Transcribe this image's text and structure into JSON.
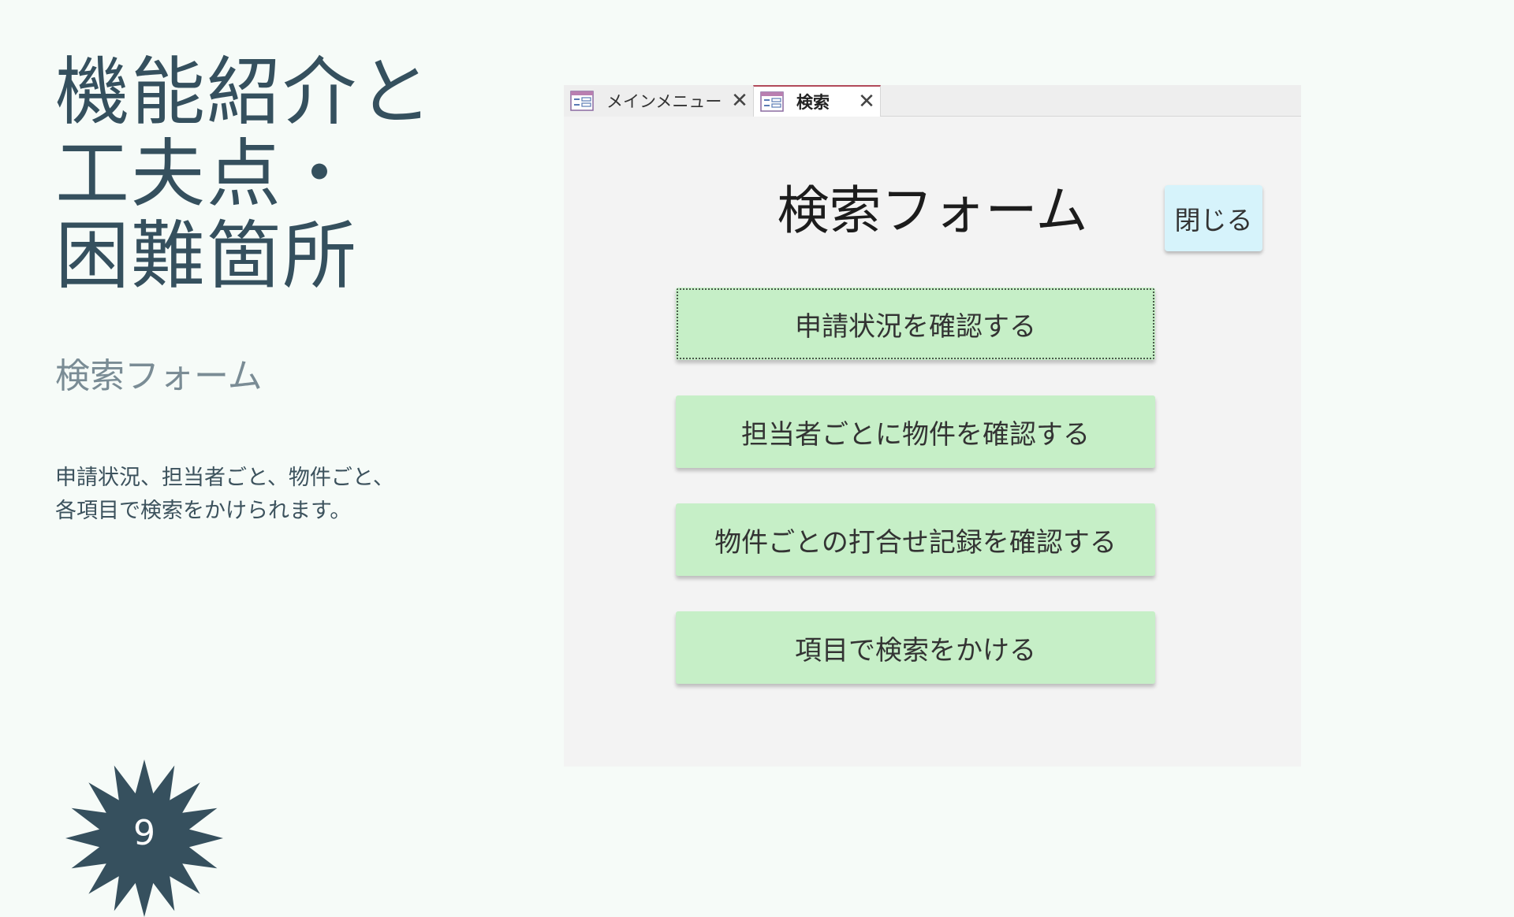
{
  "slide": {
    "title_lines": [
      "機能紹介と",
      "工夫点・",
      "困難箇所"
    ],
    "subtitle": "検索フォーム",
    "description_lines": [
      "申請状況、担当者ごと、物件ごと、",
      "各項目で検索をかけられます。"
    ],
    "page_number": "9"
  },
  "app": {
    "tabs": [
      {
        "label": "メインメニュー",
        "close": "✕",
        "icon": "form-icon",
        "active": false
      },
      {
        "label": "検索",
        "close": "✕",
        "icon": "form-icon",
        "active": true
      }
    ],
    "form": {
      "title": "検索フォーム",
      "close_label": "閉じる",
      "buttons": [
        {
          "label": "申請状況を確認する",
          "focused": true
        },
        {
          "label": "担当者ごとに物件を確認する",
          "focused": false
        },
        {
          "label": "物件ごとの打合せ記録を確認する",
          "focused": false
        },
        {
          "label": "項目で検索をかける",
          "focused": false
        }
      ]
    }
  },
  "colors": {
    "background": "#f6fbf8",
    "title_text": "#35505e",
    "subtitle_text": "#7a8c95",
    "badge": "#36505e",
    "panel": "#f3f3f3",
    "action_button": "#c6efc7",
    "close_button": "#d6f3fb",
    "active_tab_accent": "#b24a5a"
  }
}
